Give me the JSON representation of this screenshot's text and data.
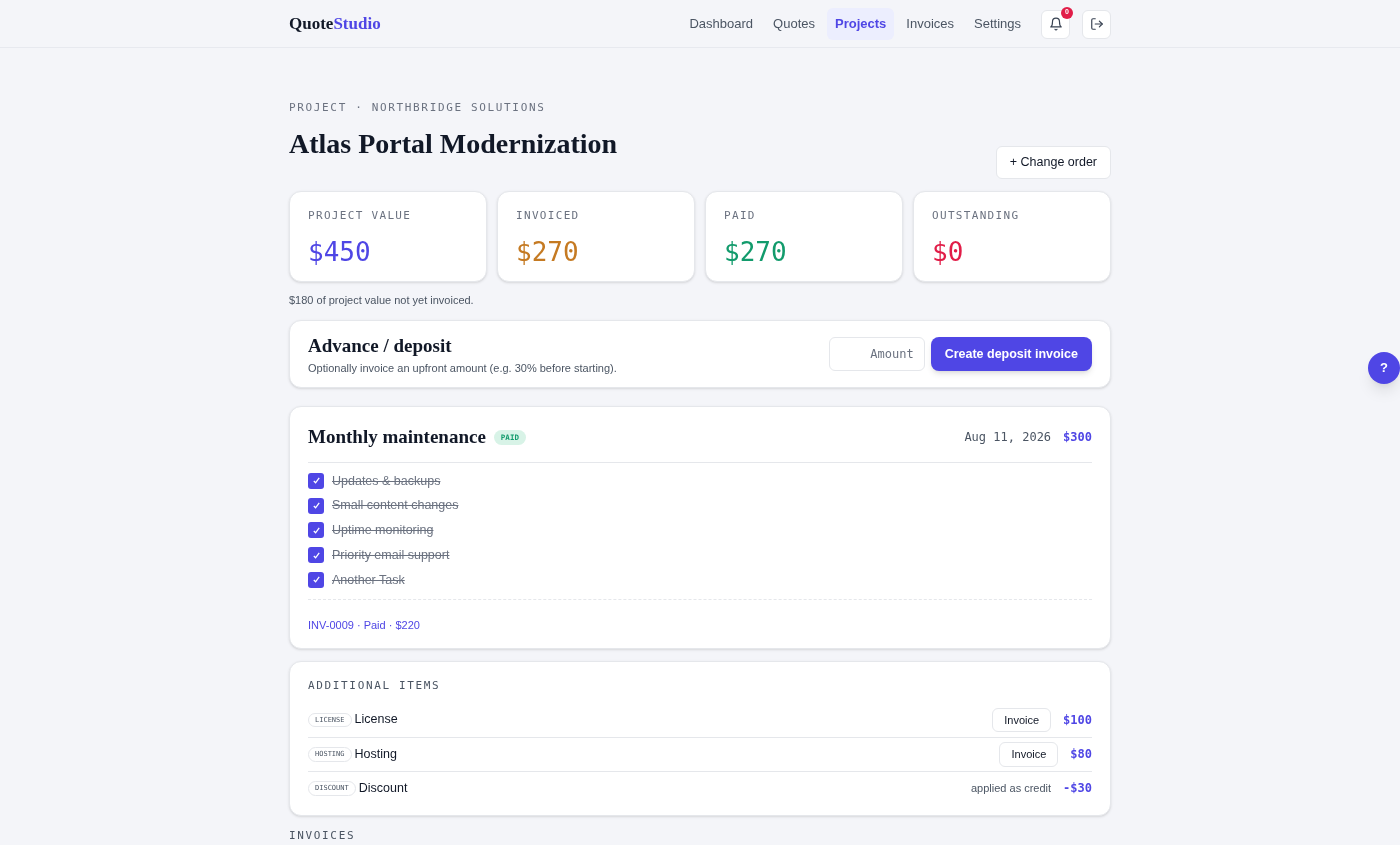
{
  "brand": {
    "part_1": "Quote",
    "part_2": "Studio"
  },
  "nav": [
    {
      "label": "Dashboard",
      "selected": false
    },
    {
      "label": "Quotes",
      "selected": false
    },
    {
      "label": "Projects",
      "selected": true
    },
    {
      "label": "Invoices",
      "selected": false
    },
    {
      "label": "Settings",
      "selected": false
    }
  ],
  "notifications": {
    "count": "0"
  },
  "project": {
    "eyebrow": "PROJECT · NORTHBRIDGE SOLUTIONS",
    "title": "Atlas Portal Modernization",
    "change_order_button": "+ Change order"
  },
  "stats": [
    {
      "label": "PROJECT VALUE",
      "value": "$450",
      "color": "#4f46e5"
    },
    {
      "label": "INVOICED",
      "value": "$270",
      "color": "#c57a22"
    },
    {
      "label": "PAID",
      "value": "$270",
      "color": "#129b6c"
    },
    {
      "label": "OUTSTANDING",
      "value": "$0",
      "color": "#e11d48"
    }
  ],
  "stats_note": "$180 of project value not yet invoiced.",
  "deposit": {
    "title": "Advance / deposit",
    "description": "Optionally invoice an upfront amount (e.g. 30% before starting).",
    "amount_placeholder": "Amount",
    "button": "Create deposit invoice"
  },
  "milestone": {
    "title": "Monthly maintenance",
    "badge": "PAID",
    "date": "Aug 11, 2026",
    "amount": "$300",
    "tasks": [
      {
        "label": "Updates & backups",
        "checked": true
      },
      {
        "label": "Small content changes",
        "checked": true
      },
      {
        "label": "Uptime monitoring",
        "checked": true
      },
      {
        "label": "Priority email support",
        "checked": true
      },
      {
        "label": "Another Task",
        "checked": true
      }
    ],
    "invoice_link": "INV-0009 · Paid · $220"
  },
  "additional_items": {
    "heading": "ADDITIONAL ITEMS",
    "items": [
      {
        "tag": "LICENSE",
        "name": "License",
        "kind": "button",
        "action": "Invoice",
        "amount": "$100"
      },
      {
        "tag": "HOSTING",
        "name": "Hosting",
        "kind": "button",
        "action": "Invoice",
        "amount": "$80"
      },
      {
        "tag": "DISCOUNT",
        "name": "Discount",
        "kind": "note",
        "action": "applied as credit",
        "amount": "-$30"
      }
    ]
  },
  "invoices_heading": "INVOICES",
  "help_button": "?"
}
